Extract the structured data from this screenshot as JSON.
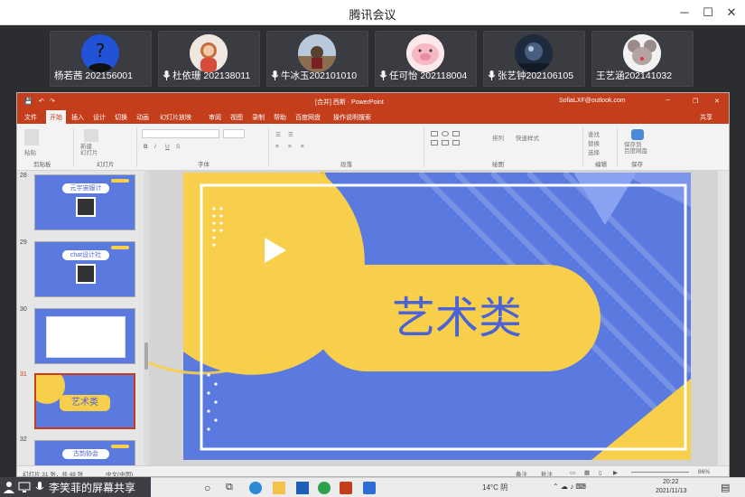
{
  "meeting": {
    "title": "腾讯会议"
  },
  "participants": [
    {
      "name": "杨若茜 202156001",
      "mic": false,
      "avatar": "avatar-question"
    },
    {
      "name": "杜依珊 202138011",
      "mic": true,
      "avatar": "avatar-photo"
    },
    {
      "name": "牛冰玉202101010",
      "mic": true,
      "avatar": "avatar-photo"
    },
    {
      "name": "任可怡 202118004",
      "mic": true,
      "avatar": "avatar-pig"
    },
    {
      "name": "张艺钟202106105",
      "mic": true,
      "avatar": "avatar-photo"
    },
    {
      "name": "王艺涵202141032",
      "mic": false,
      "avatar": "avatar-photo"
    }
  ],
  "powerpoint": {
    "doc_title": "[合并] 西斯 · PowerPoint",
    "account": "SofiaLXF@outlook.com",
    "tabs": [
      "文件",
      "开始",
      "插入",
      "设计",
      "切换",
      "动画",
      "幻灯片放映",
      "审阅",
      "视图",
      "录制",
      "帮助",
      "百度网盘"
    ],
    "tell_me": "操作说明搜索",
    "share": "共享",
    "ribbon_groups": [
      "剪贴板",
      "幻灯片",
      "字体",
      "段落",
      "绘图",
      "编辑",
      "保存"
    ],
    "ribbon_buttons": {
      "paste": "粘贴",
      "new_slide": "新建\n幻灯片",
      "find": "查找",
      "replace": "替换",
      "select": "选择",
      "save_baidu": "保存到\n百度网盘",
      "arrange": "排列",
      "quick_styles": "快速样式"
    },
    "thumbnails": [
      {
        "number": "28",
        "title": "元宇宙服计"
      },
      {
        "number": "29",
        "title": "chat设计社"
      },
      {
        "number": "30",
        "title": ""
      },
      {
        "number": "31",
        "title": "艺术类",
        "selected": true
      },
      {
        "number": "32",
        "title": "古韵协会"
      }
    ],
    "slide": {
      "title": "艺术类"
    },
    "status": {
      "slide_count": "幻灯片 31 张，共 48 张",
      "language": "中文(中国)",
      "notes": "备注",
      "comments": "批注",
      "zoom": "86%"
    }
  },
  "taskbar": {
    "screen_share": "李笑菲的屏幕共享",
    "weather": "14°C 阴",
    "time": "20:22",
    "date": "2021/11/13"
  },
  "colors": {
    "slide_blue": "#5a7ae0",
    "slide_yellow": "#f8cf4a",
    "ppt_red": "#c43e1c",
    "title_text": "#4a62d8"
  }
}
